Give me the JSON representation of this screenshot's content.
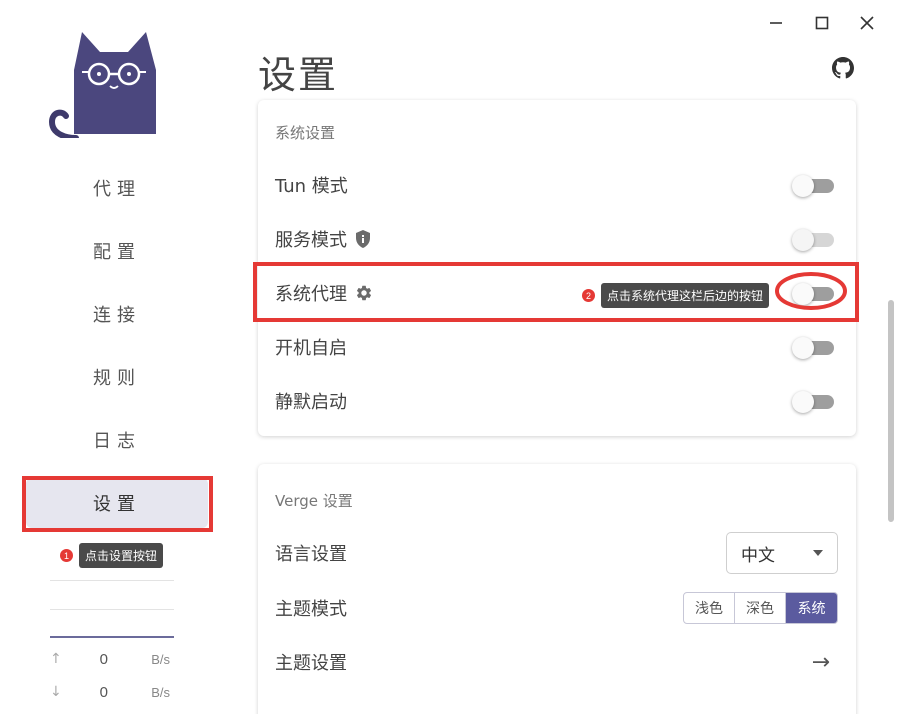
{
  "window": {
    "minimize_icon": "minimize-icon",
    "maximize_icon": "maximize-icon",
    "close_icon": "close-icon"
  },
  "brand": {
    "logo_icon": "cat-logo-icon",
    "accent": "#5b5b9f"
  },
  "sidebar": {
    "items": [
      {
        "label": "代理"
      },
      {
        "label": "配置"
      },
      {
        "label": "连接"
      },
      {
        "label": "规则"
      },
      {
        "label": "日志"
      },
      {
        "label": "设置"
      }
    ],
    "active_index": 5,
    "tip": {
      "badge": "1",
      "text": "点击设置按钮"
    },
    "traffic": {
      "up": {
        "icon": "arrow-up-icon",
        "value": "0",
        "unit": "B/s"
      },
      "down": {
        "icon": "arrow-down-icon",
        "value": "0",
        "unit": "B/s"
      }
    }
  },
  "header": {
    "title": "设置",
    "github_icon": "github-icon"
  },
  "system_settings": {
    "title": "系统设置",
    "rows": [
      {
        "label": "Tun 模式",
        "toggle": "off"
      },
      {
        "label": "服务模式",
        "icon": "shield-icon",
        "toggle": "disabled"
      },
      {
        "label": "系统代理",
        "icon": "gear-icon",
        "toggle": "off"
      },
      {
        "label": "开机自启",
        "toggle": "off"
      },
      {
        "label": "静默启动",
        "toggle": "off"
      }
    ],
    "tip": {
      "badge": "2",
      "text": "点击系统代理这栏后边的按钮"
    }
  },
  "verge_settings": {
    "title": "Verge 设置",
    "language": {
      "label": "语言设置",
      "value": "中文"
    },
    "theme_mode": {
      "label": "主题模式",
      "options": [
        "浅色",
        "深色",
        "系统"
      ],
      "selected": "系统"
    },
    "theme_settings": {
      "label": "主题设置",
      "icon": "arrow-right-icon"
    }
  },
  "highlight_color": "#e53935"
}
